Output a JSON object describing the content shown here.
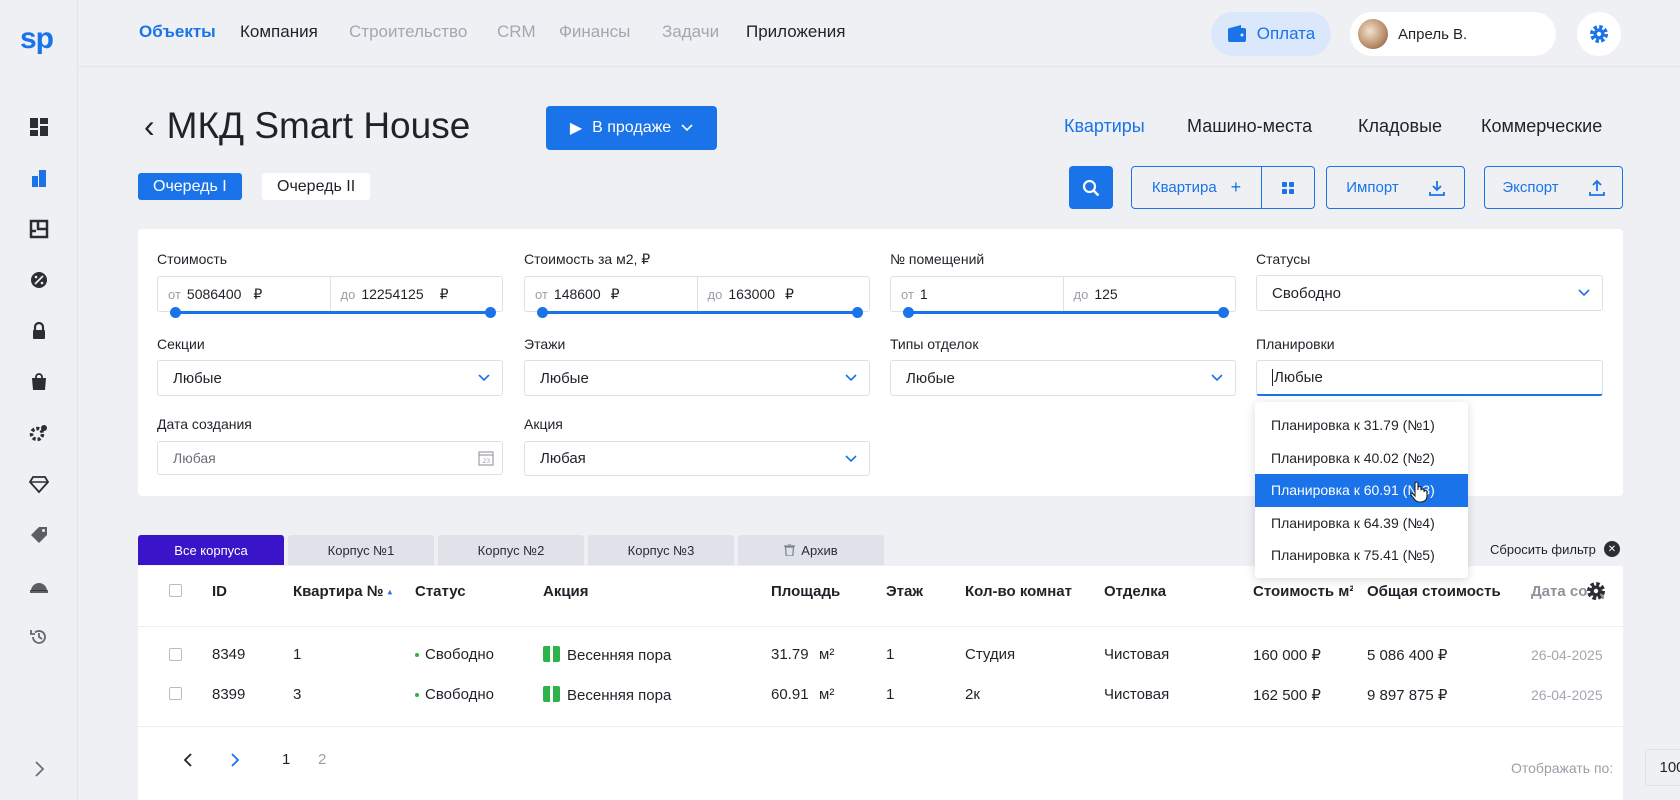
{
  "logo": "sp",
  "nav": {
    "items": [
      "Объекты",
      "Компания",
      "Строительство",
      "CRM",
      "Финансы",
      "Задачи",
      "Приложения"
    ],
    "pay_label": "Оплата",
    "user_name": "Апрель В."
  },
  "sidebar_icons": [
    "dashboard-icon",
    "buildings-icon",
    "floorplan-icon",
    "percent-icon",
    "lock-icon",
    "bag-icon",
    "settings-icon",
    "diamond-icon",
    "tag-icon",
    "helmet-icon",
    "history-icon"
  ],
  "header": {
    "title": "МКД Smart House",
    "status_label": "В продаже",
    "type_tabs": [
      "Квартиры",
      "Машино-места",
      "Кладовые",
      "Коммерческие"
    ],
    "queues": [
      "Очередь I",
      "Очередь II"
    ]
  },
  "actions": {
    "add_label": "Квартира",
    "import_label": "Импорт",
    "export_label": "Экспорт"
  },
  "filters": {
    "cost": {
      "label": "Стоимость",
      "from_prefix": "от",
      "from": "5086400",
      "to_prefix": "до",
      "to": "12254125",
      "currency": "₽"
    },
    "cost_m2": {
      "label": "Стоимость за м2, ₽",
      "from_prefix": "от",
      "from": "148600",
      "to_prefix": "до",
      "to": "163000",
      "currency": "₽"
    },
    "rooms_no": {
      "label": "№ помещений",
      "from_prefix": "от",
      "from": "1",
      "to_prefix": "до",
      "to": "125"
    },
    "statuses": {
      "label": "Статусы",
      "value": "Свободно"
    },
    "sections": {
      "label": "Секции",
      "value": "Любые"
    },
    "floors": {
      "label": "Этажи",
      "value": "Любые"
    },
    "finish_types": {
      "label": "Типы отделок",
      "value": "Любые"
    },
    "layouts": {
      "label": "Планировки",
      "value": "Любые"
    },
    "created": {
      "label": "Дата создания",
      "placeholder": "Любая"
    },
    "promo": {
      "label": "Акция",
      "value": "Любая"
    }
  },
  "layout_options": [
    "Планировка к 31.79 (№1)",
    "Планировка к 40.02 (№2)",
    "Планировка к 60.91 (№3)",
    "Планировка к 64.39 (№4)",
    "Планировка к 75.41 (№5)"
  ],
  "selected_layout_option": 2,
  "building_tabs": [
    "Все корпуса",
    "Корпус №1",
    "Корпус №2",
    "Корпус №3",
    "Архив"
  ],
  "reset_label": "Сбросить фильтр",
  "table": {
    "headers": [
      "ID",
      "Квартира №",
      "Статус",
      "Акция",
      "Площадь",
      "Этаж",
      "Кол-во комнат",
      "Отделка",
      "Стоимость м²",
      "Общая стоимость",
      "Дата созд"
    ],
    "rows": [
      {
        "id": "8349",
        "flat": "1",
        "status": "Свободно",
        "promo": "Весенняя пора",
        "area": "31.79",
        "area_unit": "м²",
        "floor": "1",
        "rooms": "Студия",
        "finish": "Чистовая",
        "price_m2": "160 000 ₽",
        "total": "5 086 400 ₽",
        "date": "26-04-2025"
      },
      {
        "id": "8399",
        "flat": "3",
        "status": "Свободно",
        "promo": "Весенняя пора",
        "area": "60.91",
        "area_unit": "м²",
        "floor": "1",
        "rooms": "2к",
        "finish": "Чистовая",
        "price_m2": "162 500 ₽",
        "total": "9 897 875 ₽",
        "date": "26-04-2025"
      }
    ]
  },
  "pager": {
    "pages": [
      "1",
      "2"
    ],
    "per_page_label": "Отображать по:",
    "per_page_value": "100"
  },
  "colors": {
    "accent": "#1a73e8",
    "active_tab": "#3a14c8",
    "status_green": "#2db34a"
  }
}
